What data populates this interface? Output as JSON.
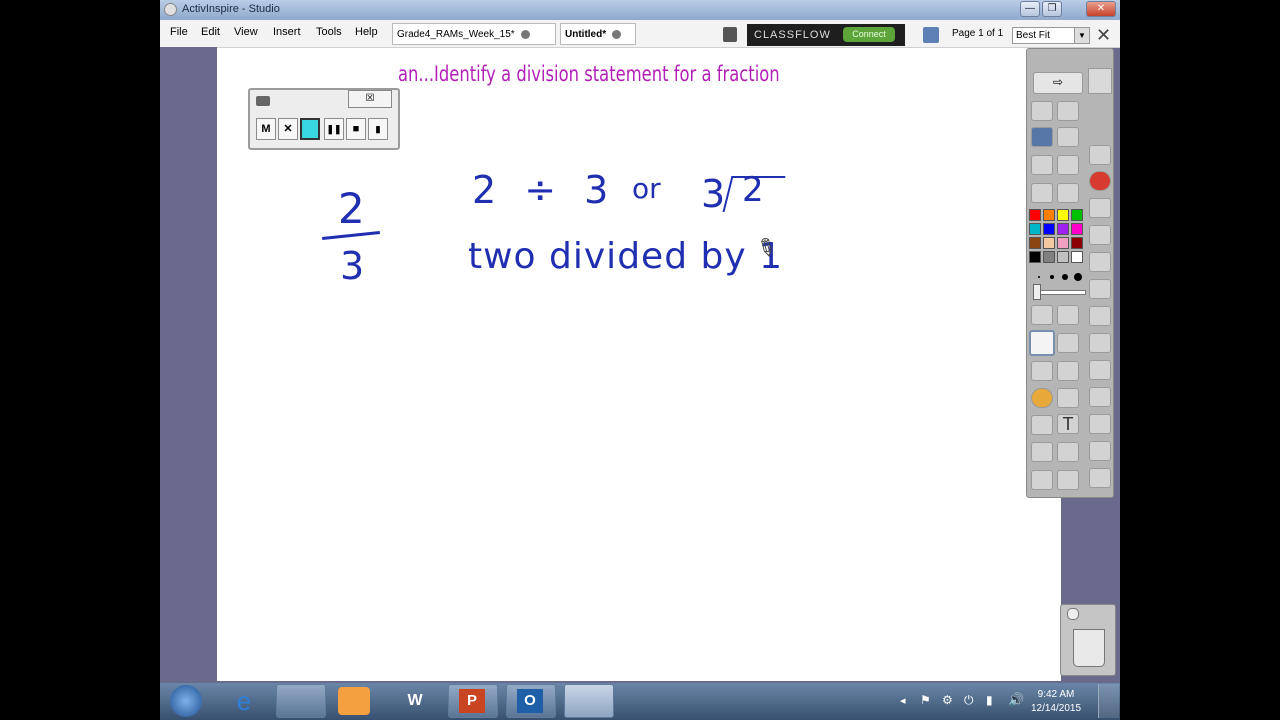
{
  "window": {
    "title": "ActivInspire - Studio"
  },
  "menubar": {
    "items": [
      "File",
      "Edit",
      "View",
      "Insert",
      "Tools",
      "Help"
    ]
  },
  "tabs": [
    {
      "label": "Grade4_RAMs_Week_15*"
    },
    {
      "label": "Untitled*"
    }
  ],
  "classflow": {
    "logo": "CLASSFLOW",
    "connect": "Connect"
  },
  "page_indicator": "Page 1 of 1",
  "zoom": {
    "selected": "Best Fit"
  },
  "recorder": {
    "buttons": [
      "M",
      "✕",
      "",
      "❚❚",
      "■",
      "▮"
    ]
  },
  "flipchart": {
    "title": "an...Identify a division statement for a fraction",
    "fraction": {
      "numerator": "2",
      "denominator": "3"
    },
    "division_expr": "2 ÷ 3",
    "or_word": "or",
    "long_div_divisor": "3",
    "long_div_dividend": "2",
    "words": "two divided by 1"
  },
  "taskbar": {
    "time": "9:42 AM",
    "date": "12/14/2015"
  },
  "colors": {
    "title_text": "#b21fb7",
    "ink": "#1f2fb0",
    "palette": [
      "#ff0000",
      "#ff8000",
      "#ffff00",
      "#00c000",
      "#00b7c8",
      "#0000ff",
      "#a020f0",
      "#ff00c8",
      "#8b4513",
      "#f5c8a0",
      "#f0a0c0",
      "#8b0000",
      "#000000",
      "#808080",
      "#c0c0c0",
      "#ffffff"
    ]
  }
}
